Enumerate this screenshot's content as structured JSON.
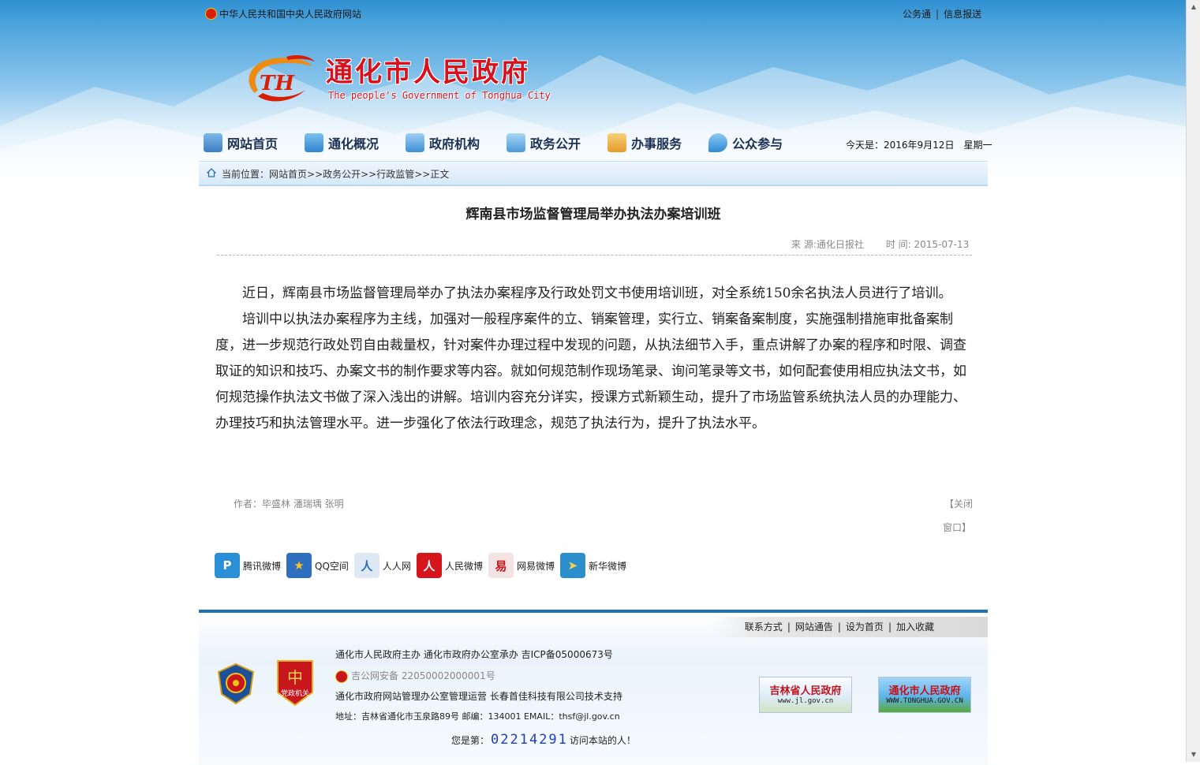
{
  "topbar": {
    "site_link": "中华人民共和国中央人民政府网站",
    "right_links": [
      "公务通",
      "信息报送"
    ]
  },
  "header": {
    "title": "通化市人民政府",
    "subtitle": "The people's Government of Tonghua City",
    "logo_text": "TH"
  },
  "nav": {
    "items": [
      {
        "label": "网站首页",
        "icon": "home-icon",
        "color": "#3b7cc4"
      },
      {
        "label": "通化概况",
        "icon": "overview-icon",
        "color": "#2f85cf"
      },
      {
        "label": "政府机构",
        "icon": "org-icon",
        "color": "#3d8fd6"
      },
      {
        "label": "政务公开",
        "icon": "book-icon",
        "color": "#4a98d8"
      },
      {
        "label": "办事服务",
        "icon": "service-icon",
        "color": "#e59a2a"
      },
      {
        "label": "公众参与",
        "icon": "chat-icon",
        "color": "#2f8ad4"
      }
    ],
    "date": "今天是：2016年9月12日　星期一"
  },
  "breadcrumb": {
    "label": "当前位置：",
    "path": "网站首页>>政务公开>>行政监管>>正文"
  },
  "article": {
    "title": "辉南县市场监督管理局举办执法办案培训班",
    "source": "来 源:通化日报社",
    "time": "时 间: 2015-07-13",
    "paragraphs": [
      "近日，辉南县市场监督管理局举办了执法办案程序及行政处罚文书使用培训班，对全系统150余名执法人员进行了培训。",
      "培训中以执法办案程序为主线，加强对一般程序案件的立、销案管理，实行立、销案备案制度，实施强制措施审批备案制度，进一步规范行政处罚自由裁量权，针对案件办理过程中发现的问题，从执法细节入手，重点讲解了办案的程序和时限、调查取证的知识和技巧、办案文书的制作要求等内容。就如何规范制作现场笔录、询问笔录等文书，如何配套使用相应执法文书，如何规范操作执法文书做了深入浅出的讲解。培训内容充分详实，授课方式新颖生动，提升了市场监管系统执法人员的办理能力、办理技巧和执法管理水平。进一步强化了依法行政理念，规范了执法行为，提升了执法水平。"
    ],
    "author": "作者：毕盛林 潘瑞瑀 张明",
    "close_1": "【关闭",
    "close_2": "窗口】"
  },
  "share": {
    "items": [
      {
        "label": "腾讯微博",
        "icon": "tencent-weibo-icon",
        "glyph": "P",
        "color": "#2a8fd6"
      },
      {
        "label": "QQ空间",
        "icon": "qzone-icon",
        "glyph": "★",
        "color": "#2e6fbf"
      },
      {
        "label": "人人网",
        "icon": "renren-icon",
        "glyph": "人",
        "color": "#2d6db8"
      },
      {
        "label": "人民微博",
        "icon": "people-weibo-icon",
        "glyph": "人",
        "color": "#d6141c"
      },
      {
        "label": "网易微博",
        "icon": "netease-weibo-icon",
        "glyph": "易",
        "color": "#c8161d"
      },
      {
        "label": "新华微博",
        "icon": "xinhua-weibo-icon",
        "glyph": "➤",
        "color": "#2c8fcc"
      }
    ]
  },
  "footer": {
    "links": [
      "联系方式",
      "网站通告",
      "设为首页",
      "加入收藏"
    ],
    "line1": "通化市人民政府主办 通化市政府办公室承办 吉ICP备05000673号",
    "police": "吉公网安备 22050002000001号",
    "line3": "通化市政府网站管理办公室管理运营 长春首佳科技有限公司技术支持",
    "line4": "地址：吉林省通化市玉泉路89号 邮编：134001 EMAIL：thsf@jl.gov.cn",
    "badge2_text": "党政机关",
    "gov_links": [
      {
        "title": "吉林省人民政府",
        "url": "www.jl.gov.cn"
      },
      {
        "title": "通化市人民政府",
        "url": "WWW.TONGHUA.GOV.CN"
      }
    ],
    "counter_prefix": "您是第：",
    "counter_value": "02214291",
    "counter_suffix": "访问本站的人！"
  }
}
